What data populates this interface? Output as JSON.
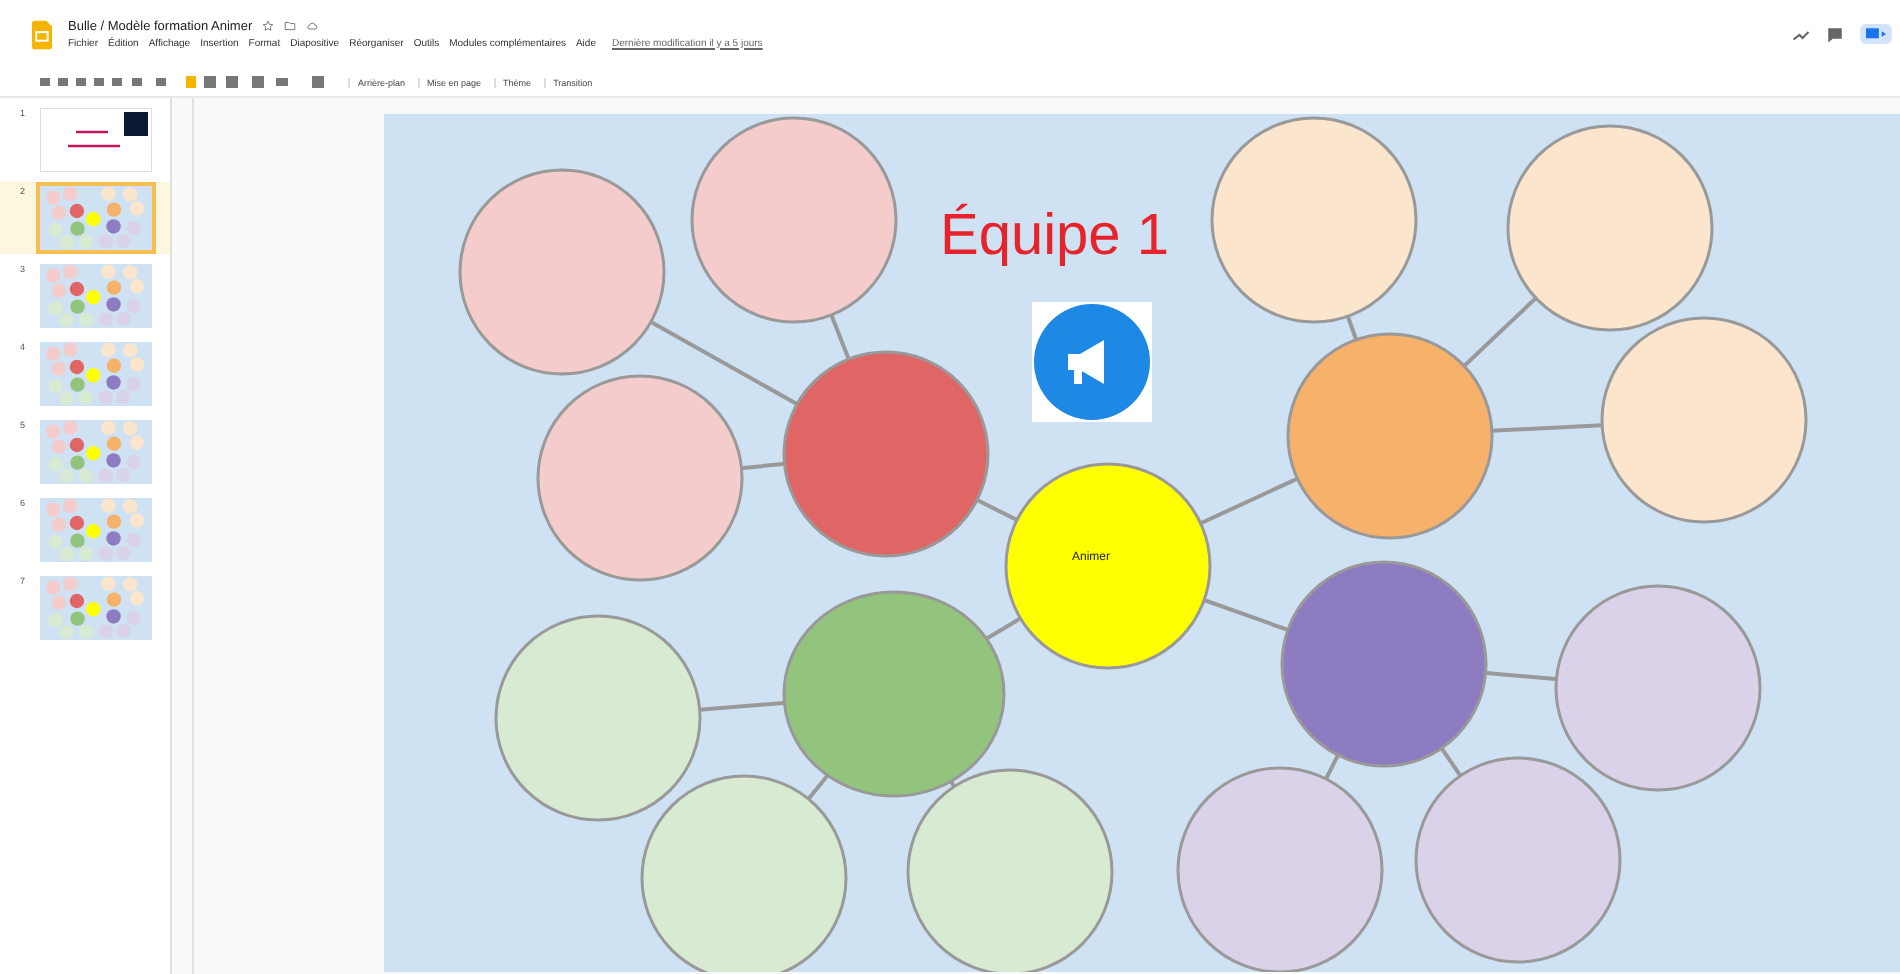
{
  "document": {
    "title": "Bulle / Modèle formation Animer"
  },
  "menu": [
    "Fichier",
    "Édition",
    "Affichage",
    "Insertion",
    "Format",
    "Diapositive",
    "Réorganiser",
    "Outils",
    "Modules complémentaires",
    "Aide"
  ],
  "last_edit": "Dernière modification il y a 5 jours",
  "toolbar": [
    "Arrière-plan",
    "Mise en page",
    "Thème",
    "Transition"
  ],
  "slides": [
    {
      "number": "1",
      "kind": "title",
      "selected": false
    },
    {
      "number": "2",
      "kind": "diagram",
      "selected": true
    },
    {
      "number": "3",
      "kind": "diagram",
      "selected": false
    },
    {
      "number": "4",
      "kind": "diagram",
      "selected": false
    },
    {
      "number": "5",
      "kind": "diagram",
      "selected": false
    },
    {
      "number": "6",
      "kind": "diagram",
      "selected": false
    },
    {
      "number": "7",
      "kind": "diagram",
      "selected": false
    }
  ],
  "slide": {
    "title": "Équipe 1",
    "center_label": "Animer"
  }
}
